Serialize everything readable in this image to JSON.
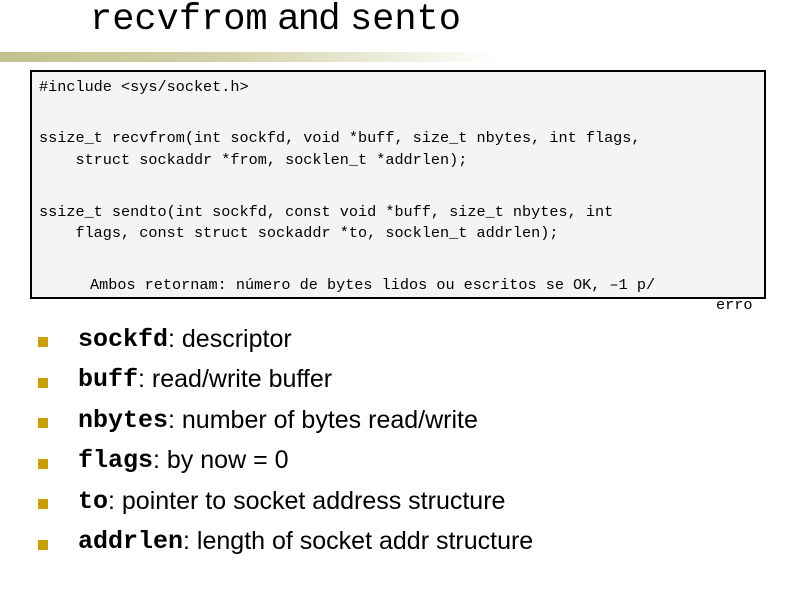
{
  "title": {
    "part1": "recvfrom",
    "part2": " and ",
    "part3": "sento"
  },
  "code": {
    "include": "#include <sys/socket.h>",
    "recvfrom_line1": "ssize_t recvfrom(int sockfd, void *buff, size_t nbytes, int flags,",
    "recvfrom_line2": "    struct sockaddr *from, socklen_t *addrlen);",
    "sendto_line1": "ssize_t sendto(int sockfd, const void *buff, size_t nbytes, int",
    "sendto_line2": "    flags, const struct sockaddr *to, socklen_t addrlen);",
    "returns": "Ambos retornam: número de bytes lidos ou escritos se OK, –1 p/",
    "returns_overflow": "erro"
  },
  "bullets": [
    {
      "term": "sockfd",
      "desc": ": descriptor"
    },
    {
      "term": "buff",
      "desc": ": read/write buffer"
    },
    {
      "term": "nbytes",
      "desc": ": number of bytes read/write"
    },
    {
      "term": "flags",
      "desc": ": by now = 0"
    },
    {
      "term": "to",
      "desc": ": pointer to socket address structure"
    },
    {
      "term": "addrlen",
      "desc": ": length of socket addr structure"
    }
  ],
  "colors": {
    "bullet": "#c8a000",
    "rule": "#c2c28e",
    "code_bg": "#f4f4f4"
  }
}
